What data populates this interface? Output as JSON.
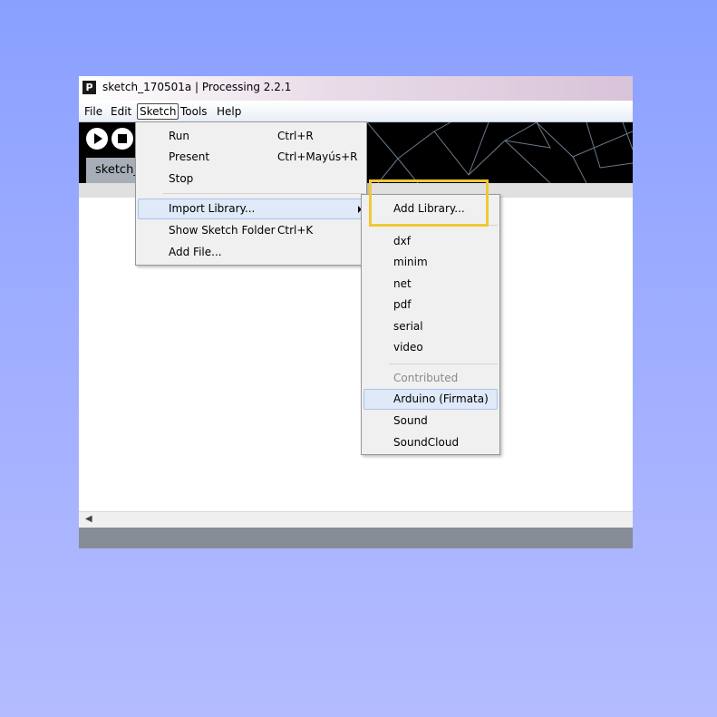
{
  "window": {
    "title": "sketch_170501a | Processing 2.2.1",
    "app_icon_letter": "P"
  },
  "menubar": {
    "items": [
      {
        "label": "File"
      },
      {
        "label": "Edit"
      },
      {
        "label": "Sketch",
        "active": true
      },
      {
        "label": "Tools"
      },
      {
        "label": "Help"
      }
    ]
  },
  "toolbar": {
    "run_icon": "play-icon",
    "stop_icon": "stop-icon",
    "tab_label": "sketch_"
  },
  "sketch_menu": {
    "items": [
      {
        "label": "Run",
        "shortcut": "Ctrl+R"
      },
      {
        "label": "Present",
        "shortcut": "Ctrl+Mayús+R"
      },
      {
        "label": "Stop",
        "shortcut": ""
      },
      {
        "label": "Import Library...",
        "shortcut": "",
        "has_submenu": true,
        "highlighted": true
      },
      {
        "label": "Show Sketch Folder",
        "shortcut": "Ctrl+K"
      },
      {
        "label": "Add File...",
        "shortcut": ""
      }
    ]
  },
  "library_submenu": {
    "add_library_label": "Add Library...",
    "core": [
      "dxf",
      "minim",
      "net",
      "pdf",
      "serial",
      "video"
    ],
    "contributed_label": "Contributed",
    "contributed": [
      {
        "label": "Arduino (Firmata)",
        "highlighted": true
      },
      {
        "label": "Sound"
      },
      {
        "label": "SoundCloud"
      }
    ]
  },
  "colors": {
    "highlight_box": "#f0c833",
    "menu_highlight": "#dfe9f8",
    "statusbar": "#868d96"
  }
}
